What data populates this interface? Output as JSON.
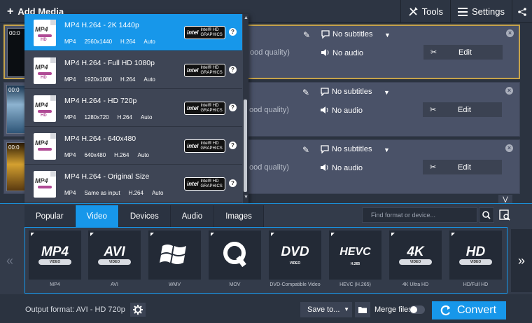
{
  "topbar": {
    "add_media": "Add Media",
    "tools": "Tools",
    "settings": "Settings"
  },
  "files": [
    {
      "time": "00:0",
      "quality": "ood quality)",
      "subtitles": "No subtitles",
      "audio": "No audio",
      "edit": "Edit"
    },
    {
      "time": "00:0",
      "quality": "ood quality)",
      "subtitles": "No subtitles",
      "audio": "No audio",
      "edit": "Edit"
    },
    {
      "time": "00:0",
      "quality": "ood quality)",
      "subtitles": "No subtitles",
      "audio": "No audio",
      "edit": "Edit"
    }
  ],
  "dropdown": {
    "items": [
      {
        "title": "MP4 H.264 - 2K 1440p",
        "specs": [
          "MP4",
          "2560x1440",
          "H.264",
          "Auto"
        ],
        "icon_text": "MP4",
        "icon_sub": "HD",
        "badge_top": "intel",
        "badge_line1": "Intel® HD",
        "badge_line2": "GRAPHICS",
        "help": "?"
      },
      {
        "title": "MP4 H.264 - Full HD 1080p",
        "specs": [
          "MP4",
          "1920x1080",
          "H.264",
          "Auto"
        ],
        "icon_text": "MP4",
        "icon_sub": "HD",
        "badge_top": "intel",
        "badge_line1": "Intel® HD",
        "badge_line2": "GRAPHICS",
        "help": "?"
      },
      {
        "title": "MP4 H.264 - HD 720p",
        "specs": [
          "MP4",
          "1280x720",
          "H.264",
          "Auto"
        ],
        "icon_text": "MP4",
        "icon_sub": "HD",
        "badge_top": "intel",
        "badge_line1": "Intel® HD",
        "badge_line2": "GRAPHICS",
        "help": "?"
      },
      {
        "title": "MP4 H.264 - 640x480",
        "specs": [
          "MP4",
          "640x480",
          "H.264",
          "Auto"
        ],
        "icon_text": "MP4",
        "icon_sub": "",
        "badge_top": "intel",
        "badge_line1": "Intel® HD",
        "badge_line2": "GRAPHICS",
        "help": "?"
      },
      {
        "title": "MP4 H.264 - Original Size",
        "specs": [
          "MP4",
          "Same as input",
          "H.264",
          "Auto"
        ],
        "icon_text": "MP4",
        "icon_sub": "",
        "badge_top": "intel",
        "badge_line1": "Intel® HD",
        "badge_line2": "GRAPHICS",
        "help": "?"
      }
    ]
  },
  "tabs": [
    "Popular",
    "Video",
    "Devices",
    "Audio",
    "Images"
  ],
  "active_tab": "Video",
  "search": {
    "placeholder": "Find format or device..."
  },
  "formats": [
    {
      "big": "MP4",
      "sub": "VIDEO",
      "label": "MP4"
    },
    {
      "big": "AVI",
      "sub": "VIDEO",
      "label": "AVI"
    },
    {
      "big": "",
      "sub": "",
      "label": "WMV"
    },
    {
      "big": "Q",
      "sub": "",
      "label": "MOV"
    },
    {
      "big": "DVD",
      "sub": "VIDEO",
      "label": "DVD-Compatible Video"
    },
    {
      "big": "HEVC",
      "sub": "H.265",
      "label": "HEVC (H.265)"
    },
    {
      "big": "4K",
      "sub": "VIDEO",
      "label": "4K Ultra HD"
    },
    {
      "big": "HD",
      "sub": "VIDEO",
      "label": "HD/Full HD"
    }
  ],
  "status": {
    "output_format": "Output format: AVI - HD 720p",
    "save_to": "Save to...",
    "merge_files": "Merge files",
    "convert": "Convert"
  },
  "colors": {
    "accent": "#1797ea",
    "selected_border": "#c6a34a",
    "background": "#2b3340"
  }
}
